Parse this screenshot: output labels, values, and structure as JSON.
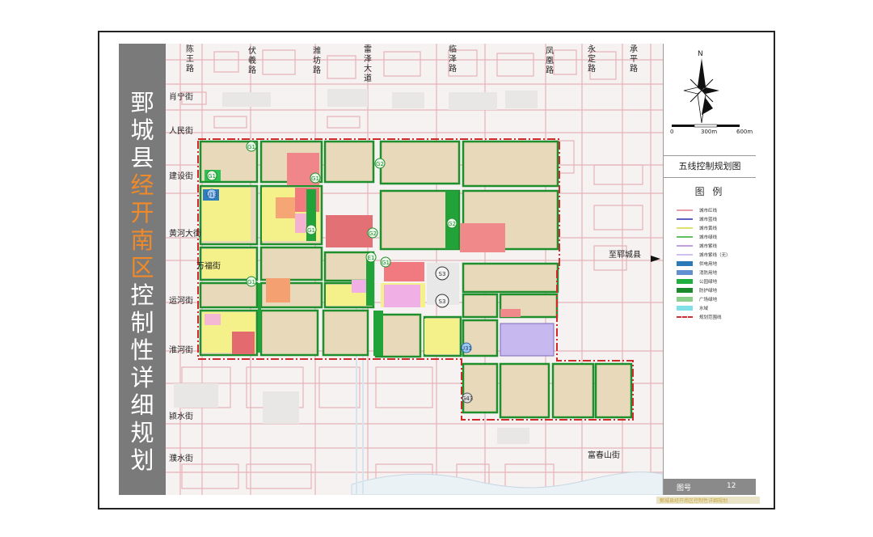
{
  "title": {
    "line1": [
      "鄄",
      "城",
      "县"
    ],
    "line2": [
      "经",
      "开",
      "南",
      "区"
    ],
    "line3": [
      "控",
      "制",
      "性",
      "详",
      "细",
      "规",
      "划"
    ]
  },
  "roads_vertical": [
    {
      "id": "chenwang",
      "chars": [
        "陈",
        "王",
        "路"
      ]
    },
    {
      "id": "fuxi",
      "chars": [
        "伏",
        "羲",
        "路"
      ]
    },
    {
      "id": "weifang",
      "chars": [
        "潍",
        "坊",
        "路"
      ]
    },
    {
      "id": "leize",
      "chars": [
        "雷",
        "泽",
        "大",
        "道"
      ]
    },
    {
      "id": "linze",
      "chars": [
        "临",
        "泽",
        "路"
      ]
    },
    {
      "id": "fenghuang",
      "chars": [
        "凤",
        "凰",
        "路"
      ]
    },
    {
      "id": "yongding",
      "chars": [
        "永",
        "定",
        "路"
      ]
    },
    {
      "id": "chengping",
      "chars": [
        "承",
        "平",
        "路"
      ]
    }
  ],
  "roads_horizontal": {
    "xiaoning": "肖宁街",
    "renmin": "人民街",
    "jianshe": "建设街",
    "huanghe": "黄河大街",
    "wanfu": "万福街",
    "yunhe": "运河街",
    "huaihe": "淮河街",
    "yingshui": "颍水街",
    "pushui": "濮水街",
    "fuchunshan": "富春山街"
  },
  "direction_label": "至郓城县",
  "scale_bar": {
    "n": "N",
    "zero": "0",
    "mid": "300m",
    "end": "600m"
  },
  "plan_title": "五线控制规划图",
  "legend_title": "图 例",
  "legend": [
    {
      "label": "城市红线",
      "color": "#e8a0a8"
    },
    {
      "label": "城市蓝线",
      "color": "#6060c0"
    },
    {
      "label": "城市黄线",
      "color": "#e0e070"
    },
    {
      "label": "城市绿线",
      "color": "#60c060"
    },
    {
      "label": "城市紫线",
      "color": "#c0a0e0"
    },
    {
      "label": "城市紫线（无）",
      "color": "#d0c0f0"
    },
    {
      "label": "供电用地",
      "color": "#2a7ab8"
    },
    {
      "label": "消防用地",
      "color": "#6090d0"
    },
    {
      "label": "公园绿地",
      "color": "#20b040"
    },
    {
      "label": "防护绿地",
      "color": "#1a8a2a"
    },
    {
      "label": "广场绿地",
      "color": "#8ad08a"
    },
    {
      "label": "水域",
      "color": "#80e0e8"
    },
    {
      "label": "规划范围线",
      "color": "#d03030"
    }
  ],
  "markers": {
    "g1": "G1",
    "g2": "G2",
    "u13": "U13",
    "e1": "E1",
    "s3": "S3",
    "u31": "U31",
    "g43": "G43"
  },
  "figure": {
    "label": "图号",
    "number": "12"
  },
  "footer": "鄄城县经开南区控制性详细规划"
}
